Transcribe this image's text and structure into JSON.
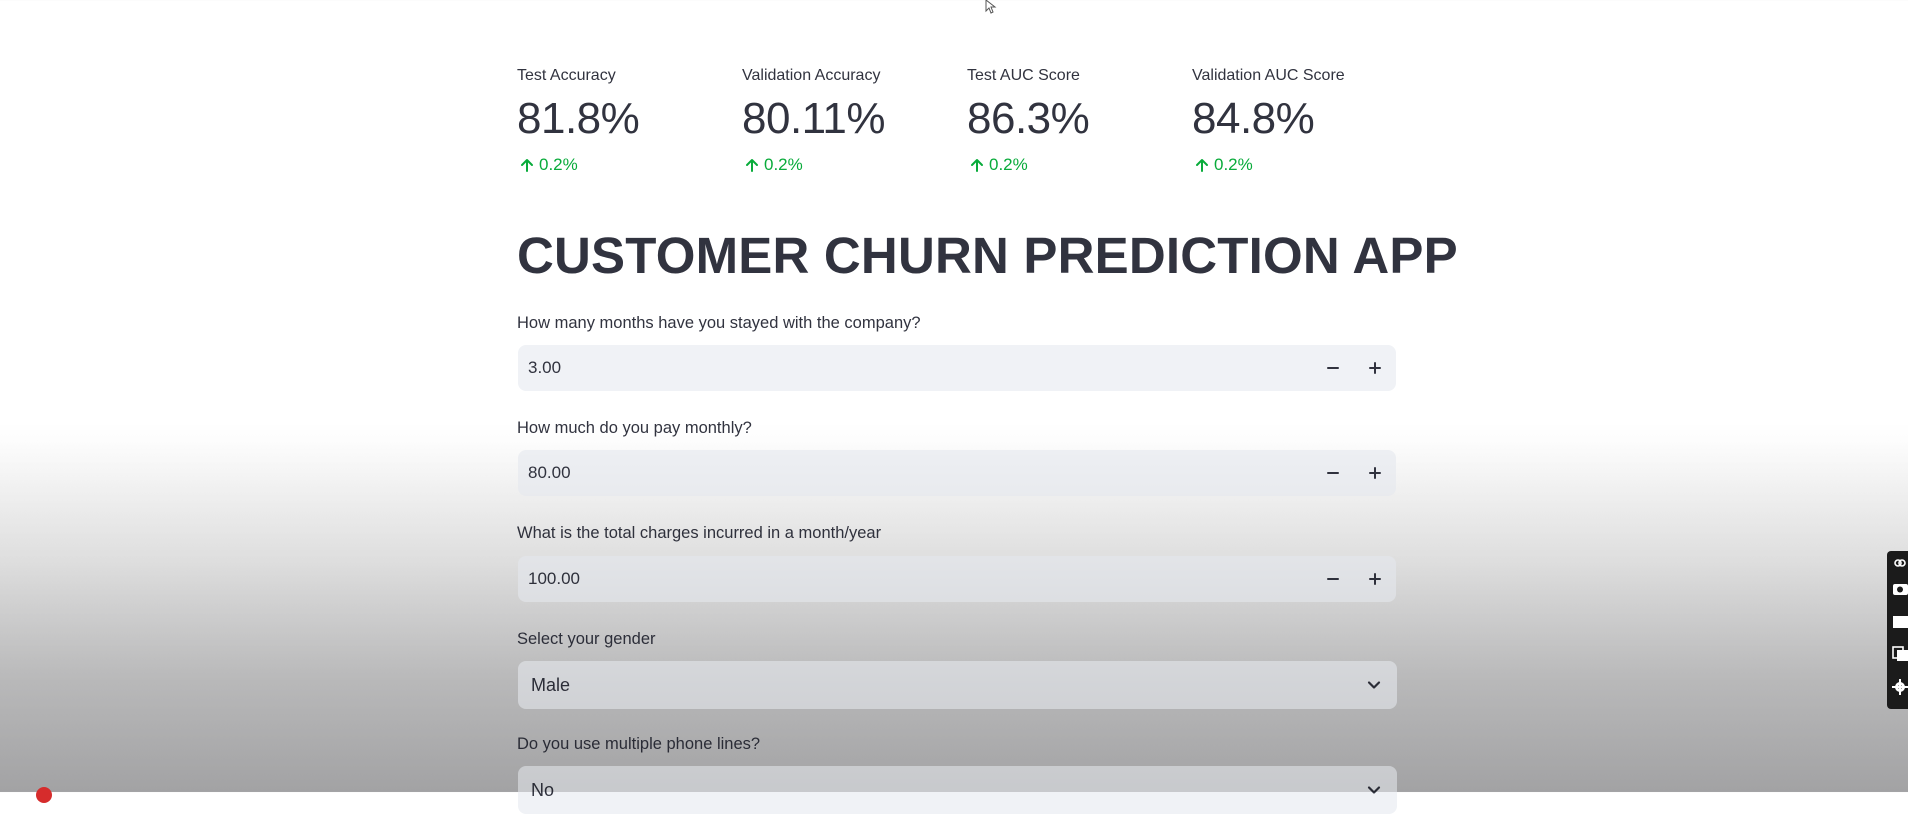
{
  "metrics": [
    {
      "label": "Test Accuracy",
      "value": "81.8%",
      "delta": "0.2%"
    },
    {
      "label": "Validation Accuracy",
      "value": "80.11%",
      "delta": "0.2%"
    },
    {
      "label": "Test AUC Score",
      "value": "86.3%",
      "delta": "0.2%"
    },
    {
      "label": "Validation AUC Score",
      "value": "84.8%",
      "delta": "0.2%"
    }
  ],
  "title": "CUSTOMER CHURN PREDICTION APP",
  "fields": {
    "tenure": {
      "label": "How many months have you stayed with the company?",
      "value": "3.00"
    },
    "monthly": {
      "label": "How much do you pay monthly?",
      "value": "80.00"
    },
    "total": {
      "label": "What is the total charges incurred in a month/year",
      "value": "100.00"
    },
    "gender": {
      "label": "Select your gender",
      "value": "Male"
    },
    "phone_lines": {
      "label": "Do you use multiple phone lines?",
      "value": "No"
    }
  },
  "colors": {
    "delta_positive": "#09ab3b",
    "input_background": "#f0f2f6",
    "text": "#31333f"
  }
}
